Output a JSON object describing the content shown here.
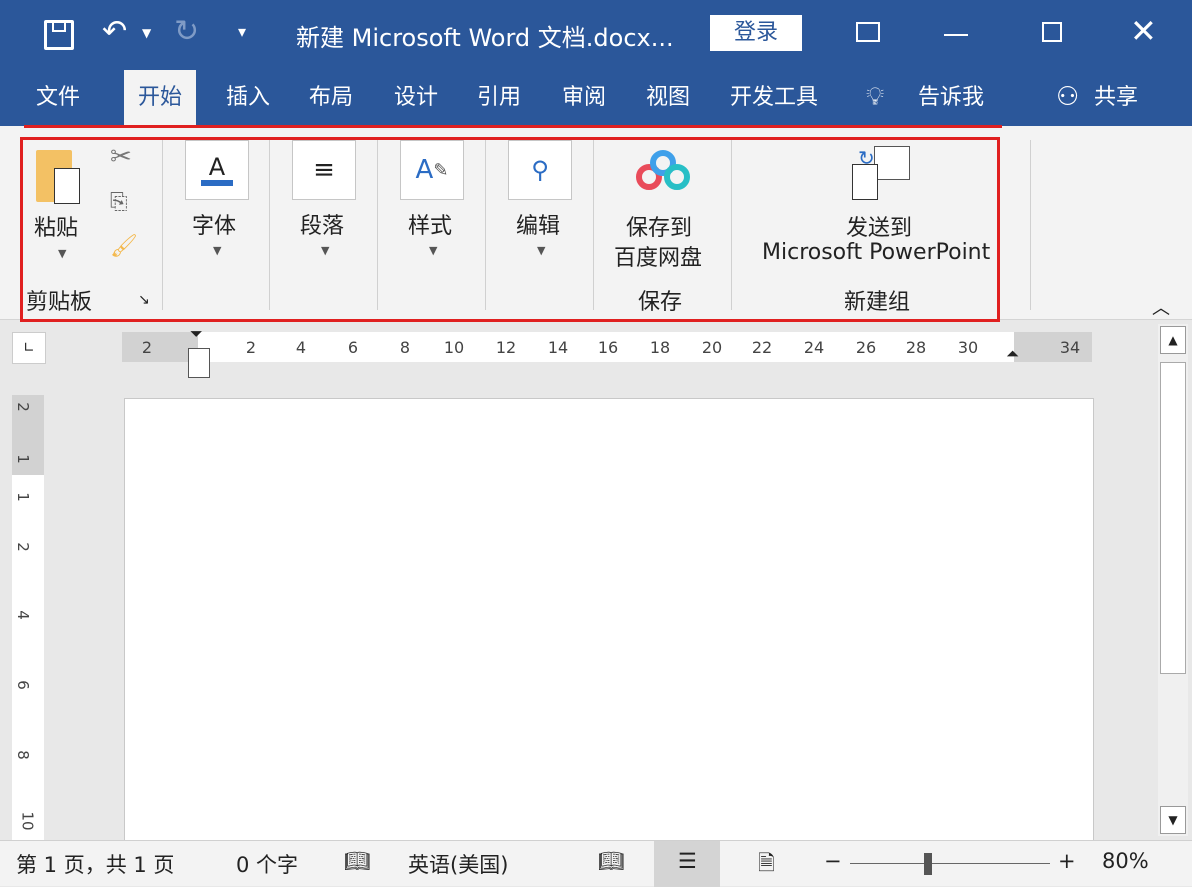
{
  "title": {
    "text": "新建 Microsoft Word 文档.docx...",
    "login": "登录"
  },
  "tabs": [
    "文件",
    "开始",
    "插入",
    "布局",
    "设计",
    "引用",
    "审阅",
    "视图",
    "开发工具",
    "告诉我"
  ],
  "share": "共享",
  "ribbon": {
    "clipboard": {
      "paste": "粘贴",
      "group": "剪贴板"
    },
    "font": "字体",
    "paragraph": "段落",
    "styles": "样式",
    "editing": "编辑",
    "save": {
      "line1": "保存到",
      "line2": "百度网盘",
      "group": "保存"
    },
    "send": {
      "line1": "发送到",
      "line2": "Microsoft PowerPoint",
      "group": "新建组"
    }
  },
  "ruler": {
    "h": [
      "2",
      "2",
      "4",
      "6",
      "8",
      "10",
      "12",
      "14",
      "16",
      "18",
      "20",
      "22",
      "24",
      "26",
      "28",
      "30",
      "34"
    ],
    "v": [
      "2",
      "1",
      "1",
      "2",
      "4",
      "6",
      "8",
      "10"
    ]
  },
  "status": {
    "page": "第 1 页，共 1 页",
    "words": "0 个字",
    "lang": "英语(美国)",
    "zoom": "80%",
    "zoom_level": 0.8
  },
  "colors": {
    "brand": "#2b579a",
    "highlight": "#e02020"
  }
}
